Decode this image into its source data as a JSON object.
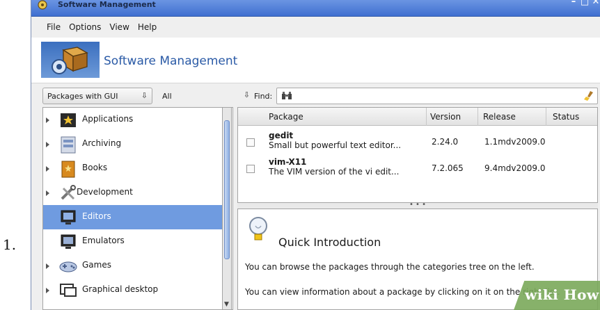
{
  "step_number": "1.",
  "window": {
    "title": "Software Management",
    "controls": [
      "–",
      "□",
      "✕"
    ]
  },
  "menubar": {
    "items": [
      "File",
      "Options",
      "View",
      "Help"
    ]
  },
  "banner": {
    "heading": "Software Management"
  },
  "filters": {
    "package_type": "Packages with GUI",
    "scope": "All",
    "find_label": "Find:",
    "find_value": ""
  },
  "tree": {
    "items": [
      {
        "label": "Applications",
        "icon": "star-box-icon",
        "expandable": true,
        "selected": false
      },
      {
        "label": "Archiving",
        "icon": "archive-icon",
        "expandable": true,
        "selected": false
      },
      {
        "label": "Books",
        "icon": "book-icon",
        "expandable": true,
        "selected": false
      },
      {
        "label": "Development",
        "icon": "tools-icon",
        "expandable": true,
        "selected": false
      },
      {
        "label": "Editors",
        "icon": "monitor-icon",
        "expandable": false,
        "selected": true
      },
      {
        "label": "Emulators",
        "icon": "monitor-icon",
        "expandable": false,
        "selected": false
      },
      {
        "label": "Games",
        "icon": "gamepad-icon",
        "expandable": true,
        "selected": false
      },
      {
        "label": "Graphical desktop",
        "icon": "desktop-icon",
        "expandable": true,
        "selected": false
      }
    ]
  },
  "packages": {
    "columns": [
      "Package",
      "Version",
      "Release",
      "Status"
    ],
    "rows": [
      {
        "name": "gedit",
        "description": "Small but powerful text editor...",
        "version": "2.24.0",
        "release": "1.1mdv2009.0",
        "status": ""
      },
      {
        "name": "vim-X11",
        "description": "The VIM version of the vi edit...",
        "version": "7.2.065",
        "release": "9.4mdv2009.0",
        "status": ""
      }
    ]
  },
  "splitter_text": "• • •",
  "info": {
    "title": "Quick Introduction",
    "paragraph1": "You can browse the packages through the categories tree on the left.",
    "paragraph2": "You can view information about a package by clicking on it on the right list."
  },
  "watermark": {
    "text": "wiki How"
  },
  "colors": {
    "titlebar": "#4a7ad6",
    "selection": "#6f9be0",
    "banner_heading": "#2a5aa6"
  }
}
